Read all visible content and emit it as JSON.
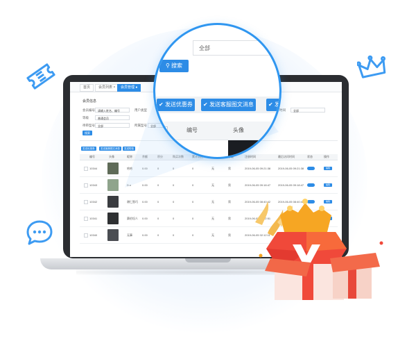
{
  "tabs": [
    {
      "label": "首页"
    },
    {
      "label": "会员列表 ×"
    },
    {
      "label": "会员管理 ●"
    }
  ],
  "page_title": "会员信息",
  "filters": {
    "member_no_label": "会员编号",
    "member_no_placeholder": "请输入姓名、编号",
    "user_type_label": "用户类型",
    "level_label": "等级",
    "level_value": "普通会员",
    "status_label": "待审型号",
    "status_value": "全部",
    "level2_label": "所属型号",
    "level2_value": "全部",
    "extra_label": "时间",
    "extra_value": "全部",
    "search_label": "搜索"
  },
  "actions": [
    {
      "label": "发送优惠券"
    },
    {
      "label": "发送客服图文消息"
    },
    {
      "label": "发送短信"
    }
  ],
  "table": {
    "headers": [
      "编号",
      "头像",
      "昵称",
      "余额",
      "积分",
      "购买次数",
      "累计消费",
      "推广员",
      "等级",
      "注册时间",
      "最后访问时间",
      "状态",
      "操作"
    ],
    "rows": [
      {
        "id": "10344",
        "name": "哈哈",
        "balance": "0.00",
        "points": "0",
        "buys": "0",
        "total": "0",
        "promoter": "无",
        "level": "男",
        "reg": "2019-06-05 09:21:38",
        "last": "2019-06-05 09:21:38",
        "op": "编辑"
      },
      {
        "id": "10343",
        "name": "D.n",
        "balance": "0.00",
        "points": "0",
        "buys": "0",
        "total": "0",
        "promoter": "无",
        "level": "男",
        "reg": "2019-06-05 09:18:47",
        "last": "2019-06-05 09:18:47",
        "op": "编辑"
      },
      {
        "id": "10342",
        "name": "谢仁智巧",
        "balance": "0.00",
        "points": "0",
        "buys": "0",
        "total": "0",
        "promoter": "无",
        "level": "男",
        "reg": "2019-06-05 08:40:42",
        "last": "2019-06-05 08:40:42",
        "op": "编辑"
      },
      {
        "id": "10341",
        "name": "赛伯坦人",
        "balance": "0.00",
        "points": "0",
        "buys": "0",
        "total": "0",
        "promoter": "无",
        "level": "男",
        "reg": "2019-06-05 03:02:51",
        "last": "2019-06-05 03:02:51",
        "op": "编辑"
      },
      {
        "id": "10340",
        "name": "无事",
        "balance": "0.00",
        "points": "0",
        "buys": "0",
        "total": "0",
        "promoter": "无",
        "level": "男",
        "reg": "2019-06-05 02:12:11",
        "last": "2019-06-05 02:12:11",
        "op": "编辑"
      }
    ]
  },
  "magnifier": {
    "select_value": "全部",
    "search_label": "搜索",
    "buttons": [
      {
        "label": "发送优惠券"
      },
      {
        "label": "发送客服图文消息"
      },
      {
        "label": "发"
      }
    ],
    "headers": [
      "编号",
      "头像"
    ]
  },
  "colors": {
    "accent": "#2d8ce6",
    "ring": "#2f96f0",
    "gift_red": "#f0493a",
    "crown": "#f6a623"
  },
  "icons": [
    "ticket-icon",
    "crown-icon",
    "chat-bubble-icon",
    "check-circle-icon",
    "search-icon"
  ]
}
